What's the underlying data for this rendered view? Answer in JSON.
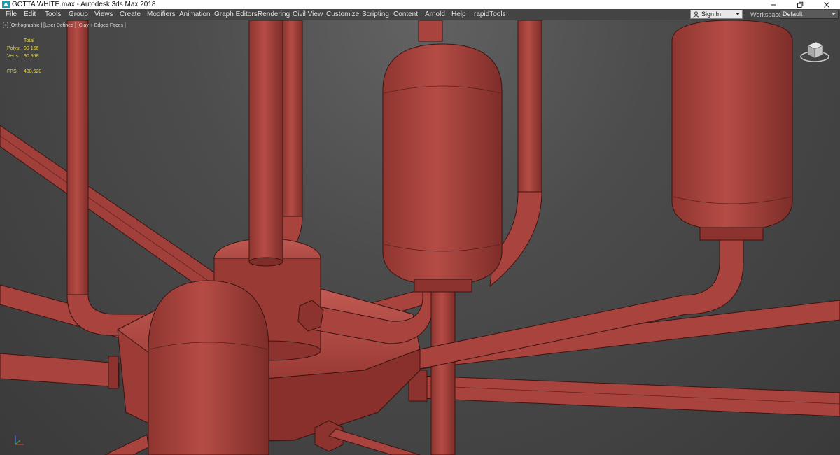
{
  "window": {
    "title": "GOTTA WHITE.max - Autodesk 3ds Max 2018",
    "controls": [
      "minimize-icon",
      "restore-icon",
      "close-icon"
    ]
  },
  "menubar": {
    "items": [
      {
        "label": "File"
      },
      {
        "label": "Edit"
      },
      {
        "label": "Tools"
      },
      {
        "label": "Group"
      },
      {
        "label": "Views"
      },
      {
        "label": "Create"
      },
      {
        "label": "Modifiers"
      },
      {
        "label": "Animation"
      },
      {
        "label": "Graph Editors"
      },
      {
        "label": "Rendering"
      },
      {
        "label": "Civil View"
      },
      {
        "label": "Customize"
      },
      {
        "label": "Scripting"
      },
      {
        "label": "Content"
      },
      {
        "label": "Arnold"
      },
      {
        "label": "Help"
      },
      {
        "label": "rapidTools"
      }
    ],
    "sign_in": "Sign In",
    "workspaces_label": "Workspaces:",
    "workspace_value": "Default"
  },
  "viewport": {
    "label": "[+] [Orthographic ] [User Defined ] [Clay + Edged Faces ]",
    "stats": {
      "header": "Total",
      "rows": [
        {
          "key": "Polys:",
          "value": "90 156"
        },
        {
          "key": "Verts:",
          "value": "90 958"
        }
      ],
      "fps_key": "FPS:",
      "fps_value": "438,520"
    },
    "model_color": "#a8433e",
    "model_edge_color": "#3a1512",
    "background_color": "#4a4a4a"
  }
}
